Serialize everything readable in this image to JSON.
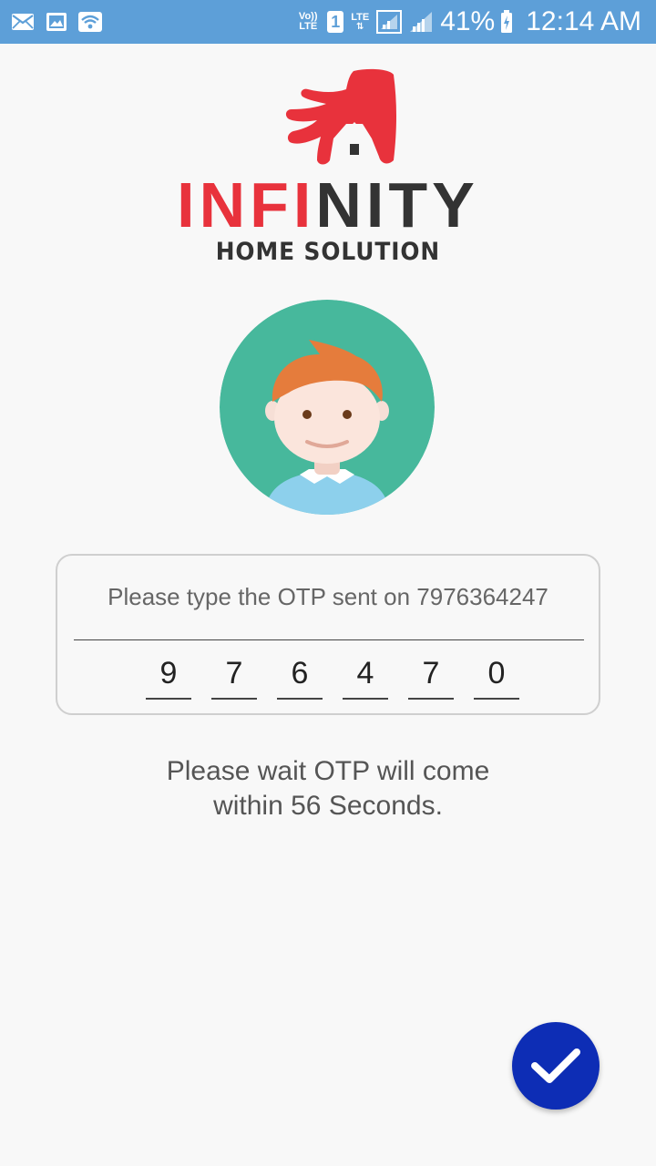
{
  "status_bar": {
    "left_icons": [
      "mail-icon",
      "image-icon",
      "wifi-icon"
    ],
    "volte_label": "Vo)) LTE",
    "sim_label": "1",
    "lte_label": "LTE",
    "battery_percent": "41%",
    "time": "12:14 AM"
  },
  "brand": {
    "name_red": "INFI",
    "name_dark": "NITY",
    "tagline": "HOME SOLUTION",
    "colors": {
      "red": "#e8323c",
      "dark": "#333333"
    }
  },
  "otp": {
    "prompt": "Please type the OTP sent on 7976364247",
    "digits": [
      "9",
      "7",
      "6",
      "4",
      "7",
      "0"
    ]
  },
  "wait_message": {
    "line1": "Please wait OTP will come",
    "line2": "within 56 Seconds."
  },
  "fab": {
    "icon": "checkmark-icon",
    "color": "#0d2db5"
  }
}
